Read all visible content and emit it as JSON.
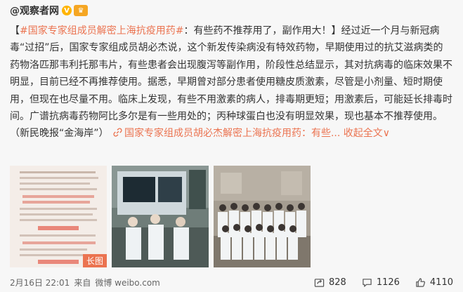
{
  "post": {
    "author": "@观察者网",
    "content": {
      "bracket_open": "【",
      "topic_tag": "#国家专家组成员解密上海抗疫用药#",
      "headline": "：有些药不推荐用了，副作用大！",
      "bracket_close": "】",
      "body": "经过近一个月与新冠病毒“过招”后，国家专家组成员胡必杰说，这个新发传染病没有特效药物，早期使用过的抗艾滋病类的药物洛匹那韦利托那韦片，有些患者会出现腹泻等副作用，阶段性总结显示，其对抗病毒的临床效果不明显，目前已经不再推荐使用。据悉，早期曾对部分患者使用糖皮质激素，尽管是小剂量、短时期使用，但现在也尽量不用。临床上发现，有些不用激素的病人，排毒期更短；用激素后，可能延长排毒时间。广谱抗病毒药物阿比多尔是有一些用处的；丙种球蛋白也没有明显效果，现也基本不推荐使用。 （新民晚报“金海岸”）",
      "link_text": "国家专家组成员胡必杰解密上海抗疫用药：有些...",
      "expand_label": "收起全文",
      "expand_arrow": "∨"
    },
    "images": {
      "long_image_label": "长图"
    },
    "meta": {
      "date": "2月16日 22:01",
      "source_prefix": "来自",
      "source": "微博 weibo.com"
    },
    "actions": {
      "reposts": "828",
      "comments": "1126",
      "likes": "4110"
    }
  },
  "colors": {
    "accent": "#eb7350",
    "background": "#f7f7f7",
    "text": "#333333",
    "meta_text": "#666666"
  }
}
